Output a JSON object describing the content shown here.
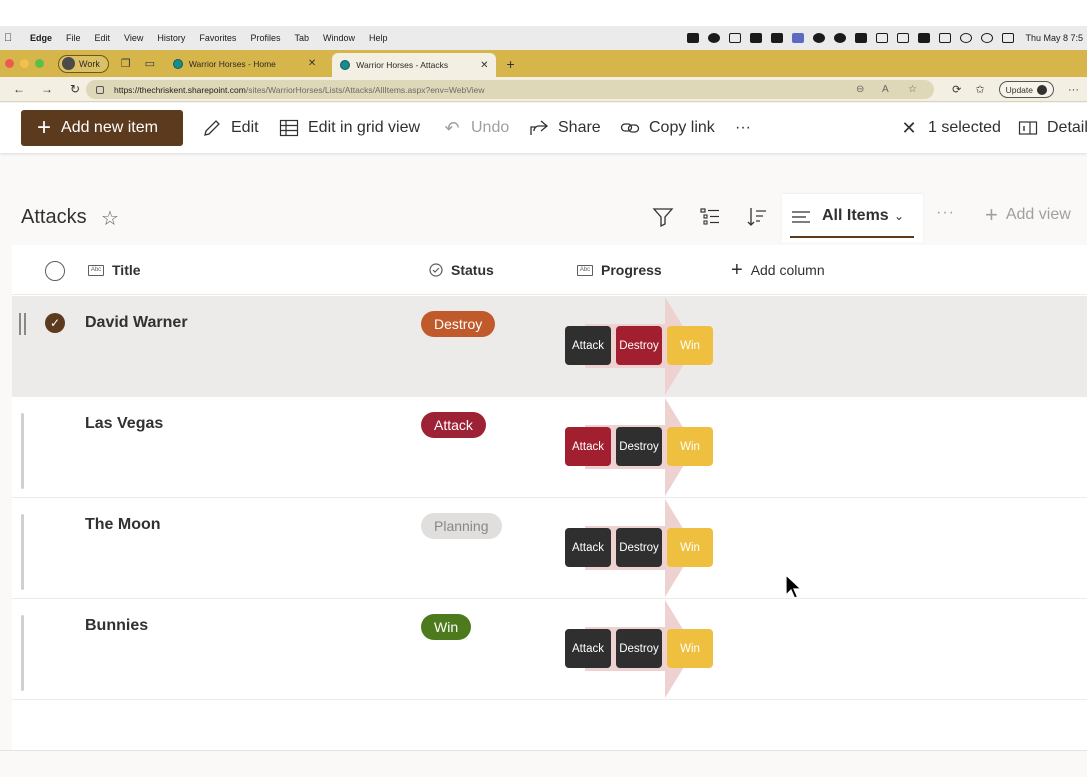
{
  "menubar": {
    "app": "Edge",
    "items": [
      "File",
      "Edit",
      "View",
      "History",
      "Favorites",
      "Profiles",
      "Tab",
      "Window",
      "Help"
    ],
    "clock": "Thu May 8  7:5"
  },
  "browser": {
    "profile": "Work",
    "tabs": [
      {
        "label": "Warrior Horses - Home",
        "active": false
      },
      {
        "label": "Warrior Horses - Attacks",
        "active": true
      }
    ],
    "url_host": "https://thechriskent.sharepoint.com",
    "url_path": "/sites/WarriorHorses/Lists/Attacks/AllItems.aspx?env=WebView",
    "update_label": "Update"
  },
  "commandbar": {
    "add_new_item": "Add new item",
    "edit": "Edit",
    "edit_grid": "Edit in grid view",
    "undo": "Undo",
    "share": "Share",
    "copy_link": "Copy link",
    "more": "···",
    "selected": "1 selected",
    "details": "Details"
  },
  "list": {
    "title": "Attacks",
    "view_name": "All Items",
    "more": "···",
    "add_view": "Add view",
    "columns": {
      "title": "Title",
      "status": "Status",
      "progress": "Progress",
      "add_column": "Add column",
      "title_icon": "Abc",
      "progress_icon": "Abc"
    },
    "stage_labels": [
      "Attack",
      "Destroy",
      "Win"
    ],
    "rows": [
      {
        "title": "David Warner",
        "status": "Destroy",
        "selected": true,
        "stages": [
          "done",
          "current",
          "todo"
        ]
      },
      {
        "title": "Las Vegas",
        "status": "Attack",
        "selected": false,
        "stages": [
          "current",
          "done",
          "todo"
        ]
      },
      {
        "title": "The Moon",
        "status": "Planning",
        "selected": false,
        "stages": [
          "done",
          "done",
          "todo"
        ]
      },
      {
        "title": "Bunnies",
        "status": "Win",
        "selected": false,
        "stages": [
          "done",
          "done",
          "todo"
        ]
      }
    ]
  },
  "colors": {
    "brand": "#5c3a1e",
    "status_destroy": "#c05a2a",
    "status_attack": "#9e2236",
    "status_planning": "#e1dfdd",
    "status_win": "#4e7a1e",
    "stage_dark": "#2f2f2f",
    "stage_red": "#a11f2f",
    "stage_gold": "#efc040",
    "arrow_bg": "#eed1d1"
  }
}
